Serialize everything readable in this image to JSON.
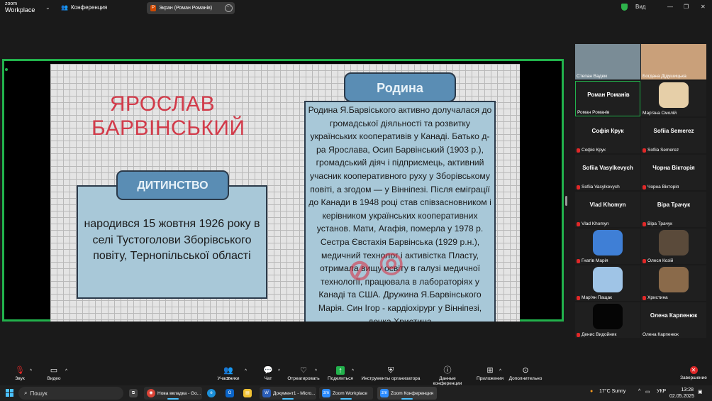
{
  "top_bar": {
    "logo_line1": "zoom",
    "logo_line2": "Workplace",
    "meeting_label": "Конференция",
    "share_title": "Экран (Роман Романів)",
    "view_label": "Вид"
  },
  "slide": {
    "title": "ЯРОСЛАВ БАРВІНСЬКИЙ",
    "left_tag": "ДИТИНСТВО",
    "left_text": "народився 15 жовтня 1926 року в селі Тустоголови Зборівського повіту, Тернопільської області",
    "right_tag": "Родина",
    "right_text": "Родина Я.Барвіського активно долучалася до громадської діяльності та розвитку українських кооперативів у Канаді. Батько д-ра Ярослава, Осип Барвінський (1903 р.), громадський діяч і підприємець, активний учасник кооперативного руху у Зборівському повіті, а згодом — у Вінніпезі. Після еміграції до Канади в 1948 році став співзасновником і керівником українських кооперативних установ. Мати, Агафія, померла у 1978 р. Сестра Євстахія Барвінська (1929 р.н.), медичний технолог і активістка Пласту, отримала вищу освіту в галузі медичної технології, працювала в лабораторіях у Канаді та США. Дружина Я.Барвінського Марія. Син Ігор - кардіохірург у Вінніпезі, дочка Христина"
  },
  "participants": [
    {
      "name": "Степан Вадюк",
      "type": "video",
      "color": "#7a8c96"
    },
    {
      "name": "Богдана Дідушицька",
      "type": "video",
      "color": "#c9a07a"
    },
    {
      "name": "Роман Романів",
      "type": "name",
      "muted": false,
      "active": true
    },
    {
      "name": "Мар'яна Смолій",
      "type": "photo",
      "color": "#e6cfa8"
    },
    {
      "name": "Софія Крук",
      "type": "name",
      "muted": true
    },
    {
      "name": "Sofiia Semerez",
      "type": "name",
      "muted": true
    },
    {
      "name": "Sofiia Vasylkevych",
      "type": "name",
      "muted": true
    },
    {
      "name": "Чорна Вікторія",
      "type": "name",
      "muted": true
    },
    {
      "name": "Vlad Khomyn",
      "type": "name",
      "muted": true
    },
    {
      "name": "Віра Трачук",
      "type": "name",
      "muted": true
    },
    {
      "name": "Гнатів Марія",
      "type": "photo",
      "color": "#3f7fd6"
    },
    {
      "name": "Олеся Козій",
      "type": "photo",
      "color": "#5a4a3a"
    },
    {
      "name": "Мар'ян Пащак",
      "type": "photo",
      "color": "#9fc4e6"
    },
    {
      "name": "Христина",
      "type": "photo",
      "color": "#8a6a4a"
    },
    {
      "name": "Денис Видойник",
      "type": "photo",
      "color": "#050505"
    },
    {
      "name": "Олена Карпенюк",
      "type": "name",
      "muted": false
    }
  ],
  "toolbar": {
    "audio": "Звук",
    "video": "Видео",
    "participants": "Участники",
    "participants_count": "16",
    "chat": "Чат",
    "react": "Отреагировать",
    "share": "Поделиться",
    "host_tools": "Инструменты организатора",
    "meeting_info": "Данные конференции",
    "apps": "Приложения",
    "more": "Дополнительно",
    "end": "Завершение"
  },
  "taskbar": {
    "search": "Пошук",
    "tasks": [
      "Нова вкладка - Go...",
      "Документ1 - Micro...",
      "Zoom Workplace",
      "Zoom Конференция"
    ],
    "weather": "17°C Sunny",
    "lang": "УКР",
    "time": "13:28",
    "date": "02.05.2025"
  }
}
